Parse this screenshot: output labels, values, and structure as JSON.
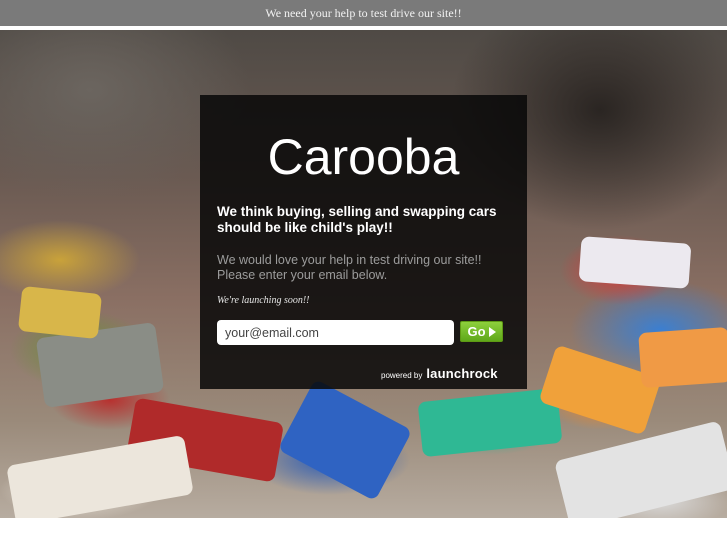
{
  "topbar": {
    "message": "We need your help to test drive our site!!"
  },
  "panel": {
    "brand": "Carooba",
    "tagline": "We think buying, selling and swapping cars should be like child's play!!",
    "blurb": "We would love your help in test driving our site!! Please enter your email below.",
    "launching": "We're launching soon!!"
  },
  "form": {
    "email_placeholder": "your@email.com",
    "go_label": "Go"
  },
  "powered": {
    "prefix": "powered by",
    "logo": "launchrock"
  },
  "colors": {
    "go_button": "#6fbb24",
    "panel_bg": "#080808",
    "topbar_bg": "#7a7a7a"
  }
}
